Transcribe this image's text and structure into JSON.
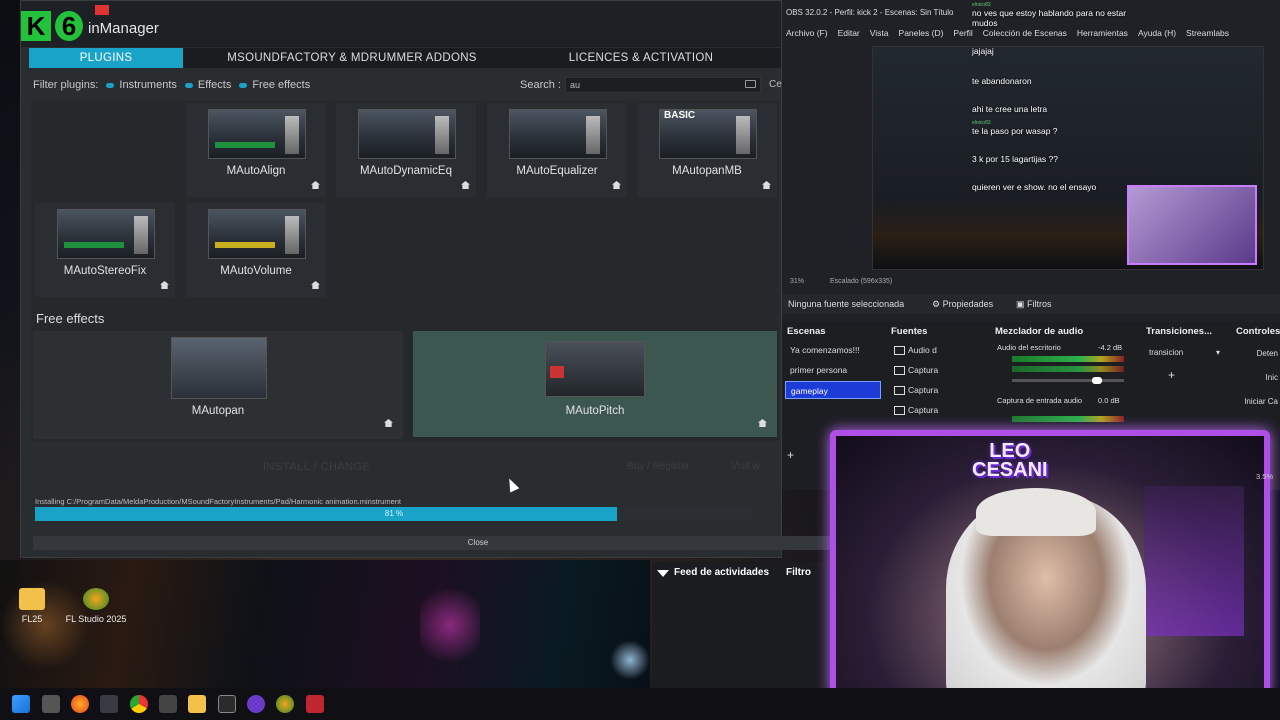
{
  "melda": {
    "title": "inManager",
    "logo": {
      "letter": "K",
      "digit": "6"
    },
    "tabs": [
      {
        "label": "PLUGINS",
        "active": true
      },
      {
        "label": "MSOUNDFACTORY & MDRUMMER ADDONS",
        "active": false
      },
      {
        "label": "LICENCES & ACTIVATION",
        "active": false
      }
    ],
    "filter": {
      "label": "Filter plugins:",
      "options": [
        "Instruments",
        "Effects",
        "Free effects"
      ]
    },
    "search": {
      "label": "Search :",
      "value": "au",
      "clear_label": "Ce"
    },
    "plugins_row1": [
      "MAutoAlign",
      "MAutoDynamicEq",
      "MAutoEqualizer",
      "MAutopanMB"
    ],
    "badge": "BASIC",
    "plugins_row2": [
      "MAutoStereoFix",
      "MAutoVolume"
    ],
    "free_effects_label": "Free effects",
    "free_effects": [
      "MAutopan",
      "MAutoPitch"
    ],
    "install_label": "INSTALL / CHANGE",
    "ghost_left": "Buy / Register",
    "ghost_right": "Visit w",
    "status": "Installing C:/ProgramData/MeldaProduction/MSoundFactoryInstruments/Pad/Harmonic animation.minstrument",
    "progress": {
      "percent": 81,
      "text": "81 %"
    },
    "close_label": "Close"
  },
  "obs": {
    "title": "OBS 32.0.2 - Perfil: kick 2 - Escenas: Sin Título",
    "menu": [
      "Archivo (F)",
      "Editar",
      "Vista",
      "Paneles (D)",
      "Perfil",
      "Colección de Escenas",
      "Herramientas",
      "Ayuda (H)",
      "Streamlabs"
    ],
    "zoom": "31%",
    "scale": "Escalado (596x335)",
    "no_source": "Ninguna fuente seleccionada",
    "properties": "Propiedades",
    "filters": "Filtros",
    "docks": {
      "scenes": "Escenas",
      "sources": "Fuentes",
      "mixer": "Mezclador de audio",
      "transitions": "Transiciones...",
      "controls": "Controles"
    },
    "scenes": [
      "Ya comenzamos!!!",
      "primer persona",
      "gameplay"
    ],
    "active_scene": "gameplay",
    "sources": [
      "Audio d",
      "Captura",
      "Captura",
      "Captura"
    ],
    "mixer": [
      {
        "label": "Audio del escritorio",
        "db": "-4.2 dB"
      },
      {
        "label": "Captura de entrada audio",
        "db": "0.0 dB"
      }
    ],
    "transition": "transicion",
    "controls": [
      "Deten",
      "Inic",
      "Iniciar Ca"
    ]
  },
  "chat": [
    {
      "user": "elnico83",
      "msg": "no ves que estoy hablando para no estar mudos"
    },
    {
      "user": "",
      "msg": "jajajaj"
    },
    {
      "user": "",
      "msg": "te abandonaron"
    },
    {
      "user": "",
      "msg": "ahi te cree una letra"
    },
    {
      "user": "elnico83",
      "msg": "te la paso por wasap ?"
    },
    {
      "user": "",
      "msg": "3 k por 15 lagartijas ??"
    },
    {
      "user": "",
      "msg": "quieren ver e show. no el ensayo"
    }
  ],
  "feed": {
    "title": "Feed de actividades",
    "filter": "Filtro"
  },
  "webcam": {
    "name_line1": "LEO",
    "name_line2": "CESANI",
    "zoom": "3.5%"
  },
  "desktop_icons": [
    "FL25",
    "FL Studio 2025"
  ]
}
